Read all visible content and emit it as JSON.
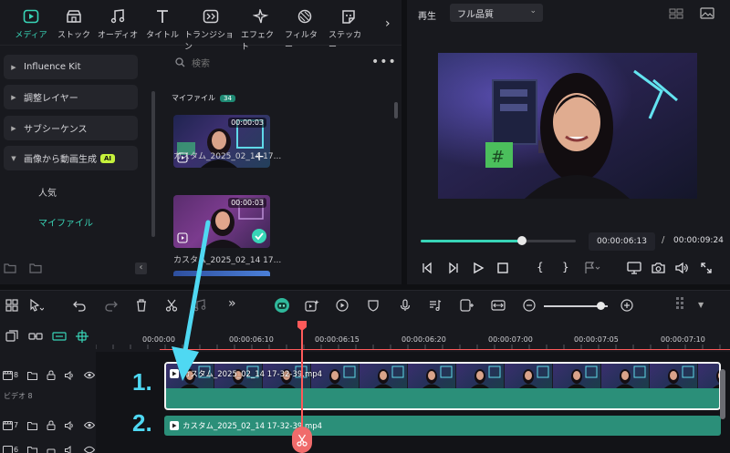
{
  "tabs": [
    {
      "label": "メディア",
      "icon": "media-icon",
      "active": true
    },
    {
      "label": "ストック",
      "icon": "stock-icon"
    },
    {
      "label": "オーディオ",
      "icon": "music-note-icon"
    },
    {
      "label": "タイトル",
      "icon": "title-t-icon"
    },
    {
      "label": "トランジション",
      "icon": "transition-icon"
    },
    {
      "label": "エフェクト",
      "icon": "effect-sparkle-icon"
    },
    {
      "label": "フィルター",
      "icon": "filter-icon"
    },
    {
      "label": "ステッカー",
      "icon": "sticker-icon"
    }
  ],
  "tab_more": "›",
  "sidebar": {
    "categories": [
      {
        "label": "Influence Kit"
      },
      {
        "label": "調整レイヤー"
      },
      {
        "label": "サブシーケンス"
      },
      {
        "label": "画像から動画生成",
        "badge": "AI",
        "expanded": true
      }
    ],
    "subitems": [
      {
        "label": "人気",
        "selected": false
      },
      {
        "label": "マイファイル",
        "selected": true
      }
    ],
    "collapse_label": "‹"
  },
  "media": {
    "search_placeholder": "検索",
    "more": "•••",
    "section_title": "マイファイル",
    "count": "34",
    "items": [
      {
        "duration": "00:00:03",
        "caption": "カスタム_2025_02_14 17..."
      },
      {
        "duration": "00:00:03",
        "caption": "カスタム_2025_02_14 17..."
      }
    ]
  },
  "preview": {
    "play_label": "再生",
    "quality": "フル品質",
    "current_time": "00:00:06:13",
    "separator": "/",
    "total_time": "00:00:09:24",
    "progress": 0.65,
    "brackets": [
      "{",
      "}"
    ]
  },
  "toolbar": {
    "zoom_level": 0.9
  },
  "timeline": {
    "ruler_labels": [
      "00:00:00",
      "00:00:06:10",
      "00:00:06:15",
      "00:00:06:20",
      "00:00:07:00",
      "00:00:07:05",
      "00:00:07:10"
    ],
    "tracks": [
      {
        "number": "8",
        "label": "ビデオ 8"
      },
      {
        "number": "7"
      },
      {
        "number": "6"
      }
    ],
    "clip1_name": "カスタム_2025_02_14 17-32-39.mp4",
    "clip2_name": "カスタム_2025_02_14 17-32-39.mp4"
  },
  "annotations": {
    "step1": "1.",
    "step2": "2.",
    "accent_color": "#4fd8f2"
  }
}
